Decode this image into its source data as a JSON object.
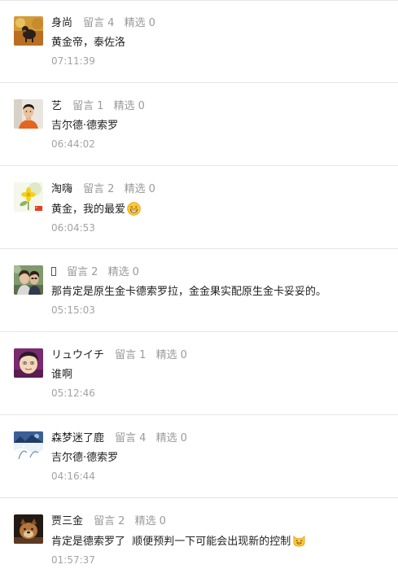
{
  "labels": {
    "reply_count_label": "留言",
    "featured_label": "精选"
  },
  "comments": [
    {
      "nickname": "身尚",
      "reply_count": "4",
      "featured_count": "0",
      "text": "黄金帝，泰佐洛",
      "time": "07:11:39",
      "avatar": "dog-on-autumn-leaves-avatar"
    },
    {
      "nickname": "艺",
      "reply_count": "1",
      "featured_count": "0",
      "text": "吉尔德·德索罗",
      "time": "06:44:02",
      "avatar": "man-orange-shirt-avatar"
    },
    {
      "nickname": "淘嗨",
      "reply_count": "2",
      "featured_count": "0",
      "text": "黄金，我的最爱",
      "time": "06:04:53",
      "avatar": "yellow-flower-avatar",
      "emoji": "grinning-face-emoji"
    },
    {
      "nickname": "",
      "reply_count": "2",
      "featured_count": "0",
      "text": "那肯定是原生金卡德索罗拉，金金果实配原生金卡妥妥的。",
      "time": "05:15:03",
      "avatar": "couple-photo-avatar"
    },
    {
      "nickname": "リュウイチ",
      "reply_count": "1",
      "featured_count": "0",
      "text": "谁啊",
      "time": "05:12:46",
      "avatar": "cartoon-face-avatar"
    },
    {
      "nickname": "森梦迷了鹿",
      "reply_count": "4",
      "featured_count": "0",
      "text": "吉尔德·德索罗",
      "time": "04:16:44",
      "avatar": "winter-scene-avatar"
    },
    {
      "nickname": "贾三金",
      "reply_count": "2",
      "featured_count": "0",
      "text": "肯定是德索罗了  顺便预判一下可能会出现新的控制",
      "time": "01:57:37",
      "avatar": "dog-dark-avatar",
      "emoji": "cat-face-emoji"
    }
  ],
  "colors": {
    "text_primary": "#222222",
    "text_secondary": "#9a9a9a",
    "divider": "#e6e6e6"
  }
}
